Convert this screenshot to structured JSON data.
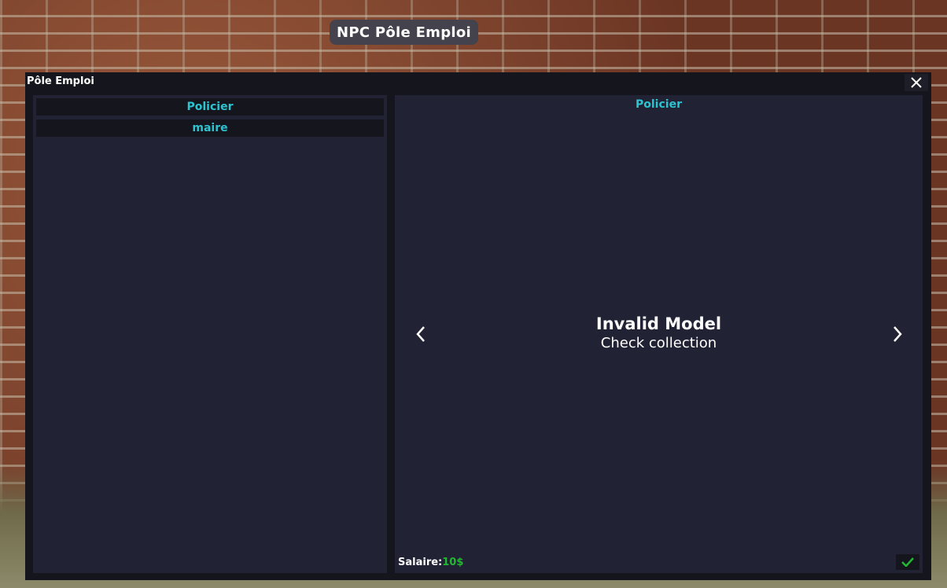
{
  "npc_tag": "NPC Pôle Emploi",
  "window": {
    "title": "Pôle Emploi",
    "close_icon": "close-icon"
  },
  "jobs": [
    {
      "label": "Policier"
    },
    {
      "label": "maire"
    }
  ],
  "detail": {
    "selected_job": "Policier",
    "model_title": "Invalid Model",
    "model_subtitle": "Check collection",
    "salary_label": "Salaire:",
    "salary_value": "10$",
    "prev_icon": "chevron-left-icon",
    "next_icon": "chevron-right-icon",
    "confirm_icon": "check-icon"
  },
  "colors": {
    "accent": "#2cc4d0",
    "salary": "#22b833",
    "panel": "#222235",
    "window": "#14151d"
  }
}
